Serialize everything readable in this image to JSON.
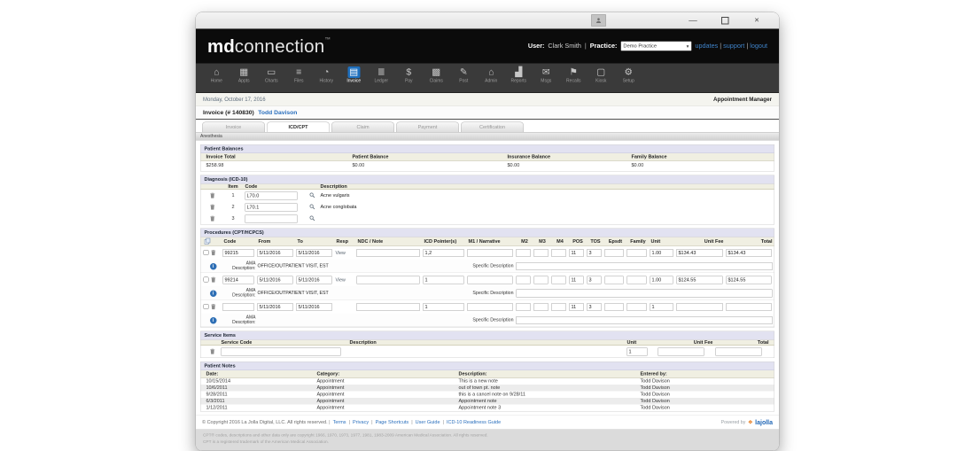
{
  "window_controls": {
    "minimize": "—",
    "close": "×"
  },
  "header": {
    "logo_md": "md",
    "logo_rest": "connection",
    "logo_tm": "™",
    "user_label": "User:",
    "user_name": "Clark Smith",
    "practice_label": "Practice:",
    "practice_value": "Demo Practice",
    "links": [
      "updates",
      "support",
      "logout"
    ]
  },
  "toolbar": {
    "items": [
      {
        "label": "Home",
        "glyph": "⌂",
        "icon": "home-icon",
        "active": false
      },
      {
        "label": "Appts",
        "glyph": "▦",
        "icon": "calendar-icon",
        "active": false
      },
      {
        "label": "Charts",
        "glyph": "▭",
        "icon": "folder-icon",
        "active": false
      },
      {
        "label": "Files",
        "glyph": "≡",
        "icon": "stack-icon",
        "active": false
      },
      {
        "label": "History",
        "glyph": "◔",
        "icon": "clock-icon",
        "active": false
      },
      {
        "label": "Invoice",
        "glyph": "▤",
        "icon": "invoice-icon",
        "active": true
      },
      {
        "label": "Ledger",
        "glyph": "≣",
        "icon": "list-icon",
        "active": false
      },
      {
        "label": "Pay",
        "glyph": "$",
        "icon": "dollar-icon",
        "active": false
      },
      {
        "label": "Claims",
        "glyph": "▩",
        "icon": "grid-icon",
        "active": false
      },
      {
        "label": "Post",
        "glyph": "✎",
        "icon": "edit-icon",
        "active": false
      },
      {
        "label": "Admin",
        "glyph": "⌂",
        "icon": "admin-home-icon",
        "active": false
      },
      {
        "label": "Reports",
        "glyph": "▟",
        "icon": "bar-chart-icon",
        "active": false
      },
      {
        "label": "Msgs",
        "glyph": "✉",
        "icon": "mail-icon",
        "active": false
      },
      {
        "label": "Recalls",
        "glyph": "⚑",
        "icon": "flag-icon",
        "active": false
      },
      {
        "label": "Kiosk",
        "glyph": "▢",
        "icon": "monitor-icon",
        "active": false
      },
      {
        "label": "Setup",
        "glyph": "⚙",
        "icon": "gear-icon",
        "active": false
      }
    ]
  },
  "statusbar": {
    "date": "Monday, October 17, 2016",
    "right_link": "Appointment Manager"
  },
  "invoice_header": {
    "title": "Invoice (# 140830)",
    "patient": "Todd Davison"
  },
  "tabs": [
    {
      "label": "Invoice",
      "active": false
    },
    {
      "label": "ICD/CPT",
      "active": true
    },
    {
      "label": "Claim",
      "active": false
    },
    {
      "label": "Payment",
      "active": false
    },
    {
      "label": "Certification",
      "active": false
    }
  ],
  "subtab_label": "Anesthesia",
  "balances": {
    "title": "Patient Balances",
    "columns": [
      "Invoice Total",
      "Patient Balance",
      "Insurance Balance",
      "Family Balance"
    ],
    "values": [
      "$258.98",
      "$0.00",
      "$0.00",
      "$0.00"
    ]
  },
  "diagnosis": {
    "title": "Diagnosis (ICD-10)",
    "columns": {
      "item": "Item",
      "code": "Code",
      "description": "Description"
    },
    "rows": [
      {
        "item": "1",
        "code": "L70.0",
        "description": "Acne vulgaris"
      },
      {
        "item": "2",
        "code": "L70.1",
        "description": "Acne conglobata"
      },
      {
        "item": "3",
        "code": "",
        "description": ""
      }
    ]
  },
  "procedures": {
    "title": "Procedures (CPT/HCPCS)",
    "columns": [
      "Code",
      "From",
      "To",
      "Resp",
      "NDC / Note",
      "ICD Pointer(s)",
      "M1 / Narrative",
      "M2",
      "M3",
      "M4",
      "POS",
      "TOS",
      "Epsdt",
      "Family",
      "Unit",
      "Unit Fee",
      "Total"
    ],
    "ama_label": "AMA Description:",
    "specific_label": "Specific Description",
    "rows": [
      {
        "code": "99215",
        "from": "5/11/2016",
        "to": "5/11/2016",
        "resp": "View",
        "ndc": "",
        "icd": "1,2",
        "m1": "",
        "m2": "",
        "m3": "",
        "m4": "",
        "pos": "11",
        "tos": "3",
        "epsdt": "",
        "family": "",
        "unit": "1.00",
        "unit_fee": "$134.43",
        "total": "$134.43",
        "ama": "OFFICE/OUTPATIENT VISIT, EST",
        "specific": ""
      },
      {
        "code": "99214",
        "from": "5/11/2016",
        "to": "5/11/2016",
        "resp": "View",
        "ndc": "",
        "icd": "1",
        "m1": "",
        "m2": "",
        "m3": "",
        "m4": "",
        "pos": "11",
        "tos": "3",
        "epsdt": "",
        "family": "",
        "unit": "1.00",
        "unit_fee": "$124.55",
        "total": "$124.55",
        "ama": "OFFICE/OUTPATIENT VISIT, EST",
        "specific": ""
      },
      {
        "code": "",
        "from": "5/11/2016",
        "to": "5/11/2016",
        "resp": "",
        "ndc": "",
        "icd": "1",
        "m1": "",
        "m2": "",
        "m3": "",
        "m4": "",
        "pos": "11",
        "tos": "3",
        "epsdt": "",
        "family": "",
        "unit": "1",
        "unit_fee": "",
        "total": "",
        "ama": "",
        "specific": ""
      }
    ]
  },
  "service_items": {
    "title": "Service Items",
    "columns": {
      "code": "Service Code",
      "description": "Description",
      "unit": "Unit",
      "unit_fee": "Unit Fee",
      "total": "Total"
    },
    "rows": [
      {
        "code": "",
        "description": "",
        "unit": "1",
        "unit_fee": "",
        "total": ""
      }
    ]
  },
  "patient_notes": {
    "title": "Patient Notes",
    "columns": [
      "Date:",
      "Category:",
      "Description:",
      "Entered by:"
    ],
    "rows": [
      {
        "date": "10/15/2014",
        "category": "Appointment",
        "description": "This is a new note",
        "entered_by": "Todd Davison"
      },
      {
        "date": "10/6/2011",
        "category": "Appointment",
        "description": "out of town pt. note",
        "entered_by": "Todd Davison"
      },
      {
        "date": "9/28/2011",
        "category": "Appointment",
        "description": "this is a cancel note on 9/28/11",
        "entered_by": "Todd Davison"
      },
      {
        "date": "6/3/2011",
        "category": "Appointment",
        "description": "Appointment note",
        "entered_by": "Todd Davison"
      },
      {
        "date": "1/12/2011",
        "category": "Appointment",
        "description": "Appointment note 3",
        "entered_by": "Todd Davison"
      }
    ]
  },
  "footer": {
    "copyright": "© Copyright 2016 La Jolla Digital, LLC. All rights reserved.",
    "links": [
      "Terms",
      "Privacy",
      "Page Shortcuts",
      "User Guide",
      "ICD-10 Readiness Guide"
    ],
    "powered_label": "Powered by",
    "powered_brand": "lajolla",
    "fine_print_1": "CPT® codes, descriptions and other data only are copyright 1966, 1970, 1973, 1977, 1981, 1983-2009 American Medical Association. All rights reserved.",
    "fine_print_2": "CPT is a registered trademark of the American Medical Association."
  }
}
